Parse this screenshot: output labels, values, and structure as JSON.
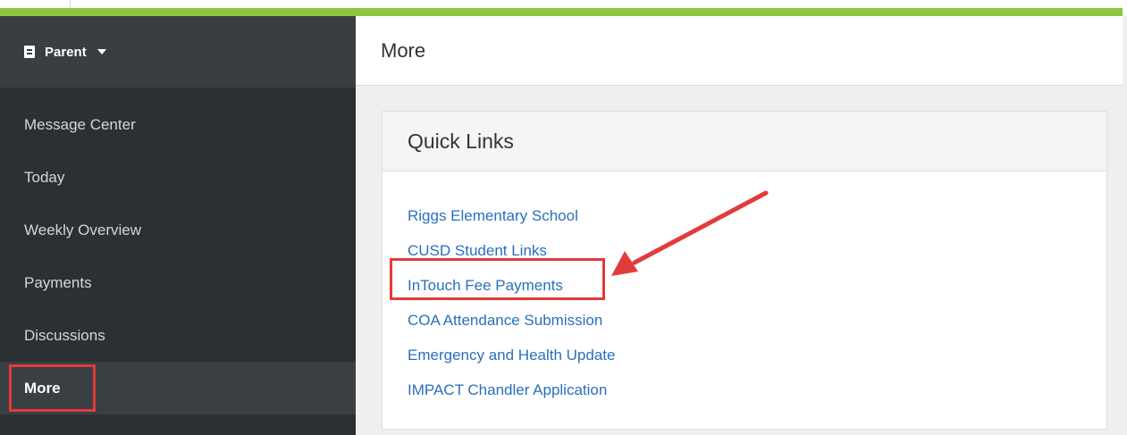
{
  "sidebar": {
    "role_label": "Parent",
    "items": [
      {
        "label": "Message Center"
      },
      {
        "label": "Today"
      },
      {
        "label": "Weekly Overview"
      },
      {
        "label": "Payments"
      },
      {
        "label": "Discussions"
      },
      {
        "label": "More"
      }
    ]
  },
  "main": {
    "title": "More",
    "card": {
      "title": "Quick Links",
      "links": [
        {
          "label": "Riggs Elementary School"
        },
        {
          "label": "CUSD Student Links"
        },
        {
          "label": "InTouch Fee Payments"
        },
        {
          "label": "COA Attendance Submission"
        },
        {
          "label": "Emergency and Health Update"
        },
        {
          "label": "IMPACT Chandler Application"
        }
      ]
    }
  },
  "colors": {
    "accent_bar": "#8cc63f",
    "sidebar_bg": "#2b3033",
    "link": "#2a6fbe",
    "annotation_red": "#e23b3b"
  },
  "icons": {
    "role_icon": "book-icon",
    "role_dropdown": "caret-down-icon"
  }
}
